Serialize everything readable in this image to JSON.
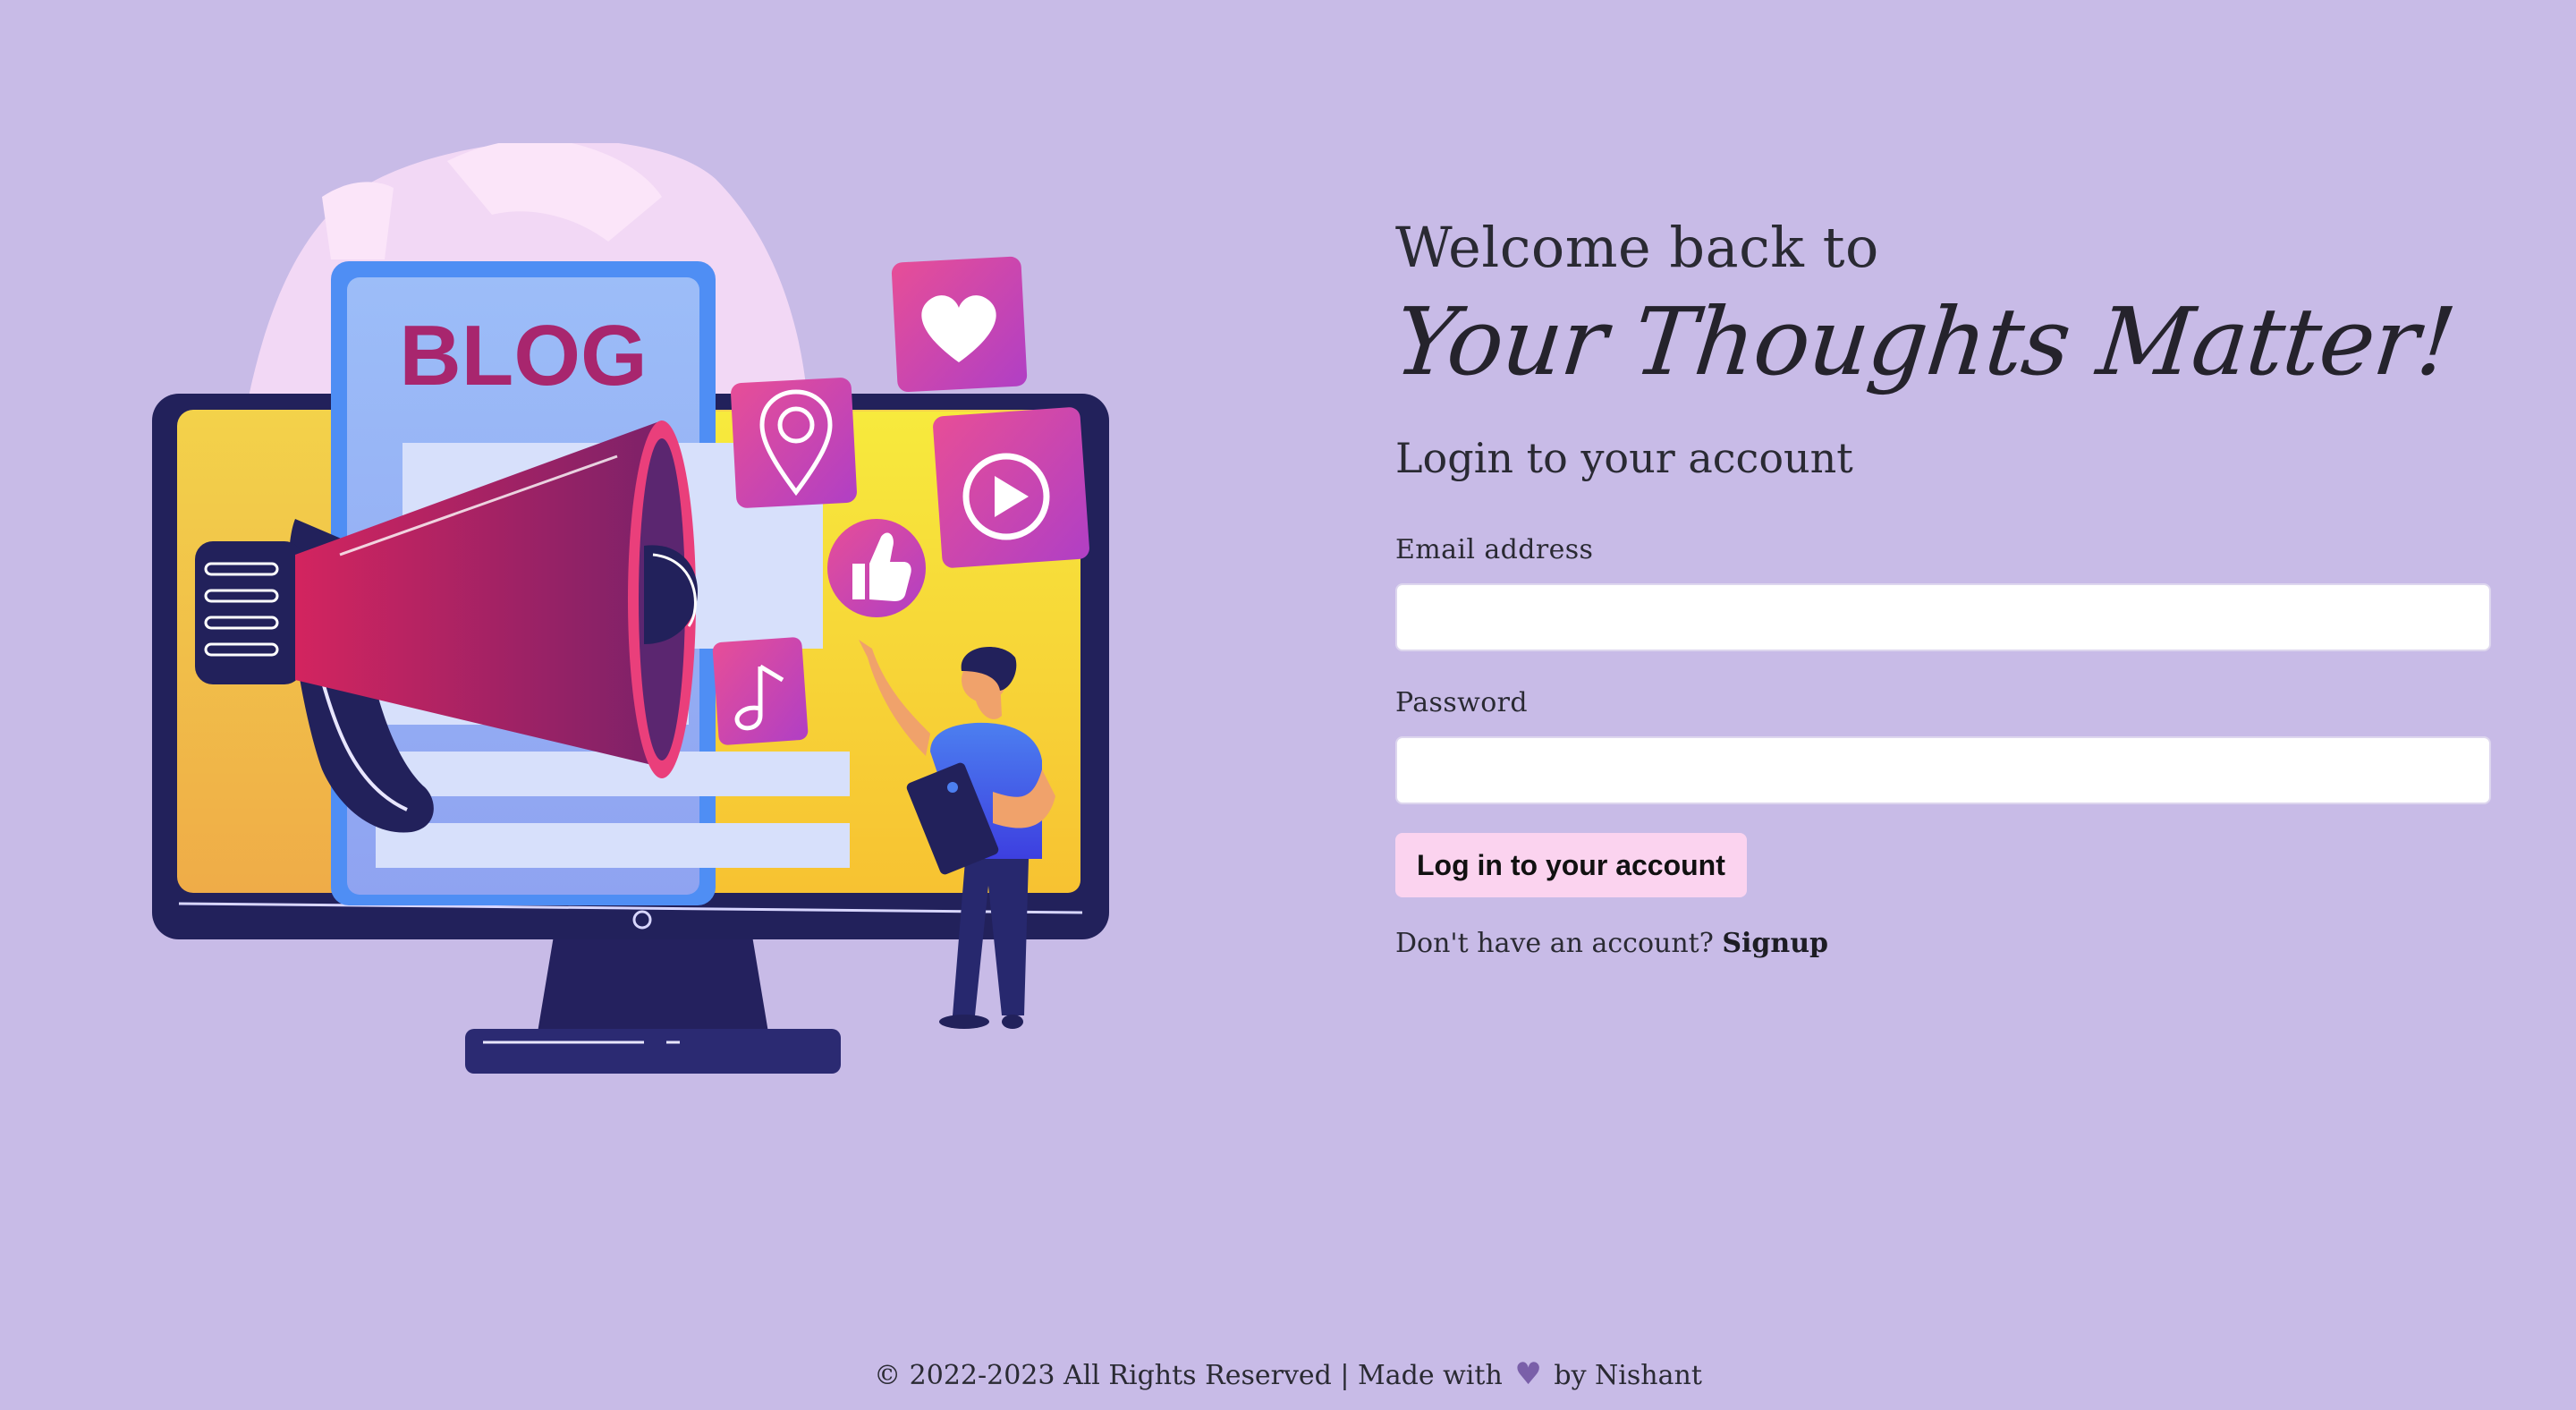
{
  "hero": {
    "welcome": "Welcome back to",
    "brand": "Your Thoughts Matter!",
    "illustration_text": "BLOG"
  },
  "form": {
    "title": "Login to your account",
    "email_label": "Email address",
    "email_value": "",
    "password_label": "Password",
    "password_value": "",
    "submit_label": "Log in to your account",
    "signup_prompt": "Don't have an account?",
    "signup_link": "Signup"
  },
  "footer": {
    "copyright": "© 2022-2023 All Rights Reserved | Made with",
    "heart_icon": "heart-icon",
    "author": "by Nishant"
  },
  "colors": {
    "background": "#c8bbe7",
    "button": "#fbd3ef",
    "heart": "#7a5fa9"
  }
}
